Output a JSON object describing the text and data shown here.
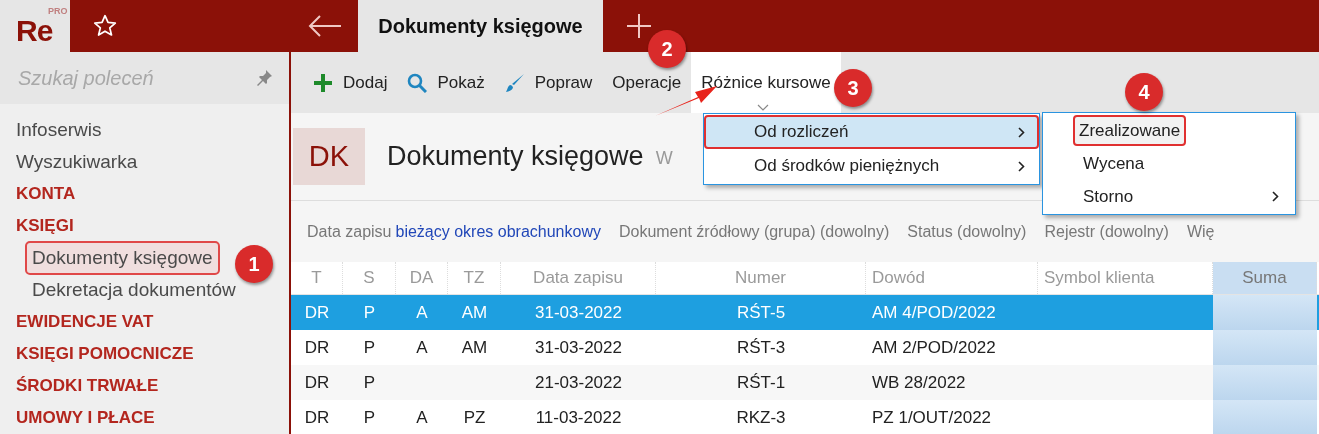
{
  "app": {
    "logo": "Re",
    "edition": "PRO"
  },
  "tabs": [
    {
      "label": "Dokumenty księgowe",
      "selected": true
    }
  ],
  "sidebar": {
    "search_placeholder": "Szukaj poleceń",
    "items": [
      {
        "label": "Infoserwis",
        "kind": "link",
        "selected": false
      },
      {
        "label": "Wyszukiwarka",
        "kind": "link",
        "selected": false
      },
      {
        "label": "KONTA",
        "kind": "section",
        "selected": false
      },
      {
        "label": "KSIĘGI",
        "kind": "section",
        "selected": false,
        "children": [
          {
            "label": "Dokumenty księgowe",
            "kind": "link",
            "selected": true
          },
          {
            "label": "Dekretacja dokumentów",
            "kind": "link",
            "selected": false
          }
        ]
      },
      {
        "label": "EWIDENCJE VAT",
        "kind": "section",
        "selected": false
      },
      {
        "label": "KSIĘGI POMOCNICZE",
        "kind": "section",
        "selected": false
      },
      {
        "label": "ŚRODKI TRWAŁE",
        "kind": "section",
        "selected": false
      },
      {
        "label": "UMOWY I PŁACE",
        "kind": "section",
        "selected": false
      }
    ]
  },
  "toolbar": [
    {
      "label": "Dodaj",
      "kind": "add",
      "open": false
    },
    {
      "label": "Pokaż",
      "kind": "show",
      "open": false
    },
    {
      "label": "Popraw",
      "kind": "edit",
      "open": false
    },
    {
      "label": "Operacje",
      "kind": "text",
      "open": false
    },
    {
      "label": "Różnice kursowe",
      "kind": "text",
      "open": true
    }
  ],
  "page_header": {
    "code": "DK",
    "title": "Dokumenty księgowe",
    "subtitle": "W"
  },
  "filters": [
    {
      "label": "Data zapisu",
      "value": "bieżący okres obrachunkowy"
    },
    {
      "label": "Dokument źródłowy (grupa) (dowolny)"
    },
    {
      "label": "Status (dowolny)"
    },
    {
      "label": "Rejestr (dowolny)"
    },
    {
      "label": "Wię"
    }
  ],
  "table": {
    "columns": [
      "T",
      "S",
      "DA",
      "TZ",
      "Data zapisu",
      "Numer",
      "Dowód",
      "Symbol klienta",
      "Suma"
    ],
    "rows": [
      {
        "selected": true,
        "cells": [
          "DR",
          "P",
          "A",
          "AM",
          "31-03-2022",
          "RŚT-5",
          "AM 4/POD/2022",
          "",
          ""
        ]
      },
      {
        "selected": false,
        "cells": [
          "DR",
          "P",
          "A",
          "AM",
          "31-03-2022",
          "RŚT-3",
          "AM 2/POD/2022",
          "",
          ""
        ]
      },
      {
        "selected": false,
        "cells": [
          "DR",
          "P",
          "",
          "",
          "21-03-2022",
          "RŚT-1",
          "WB 28/2022",
          "",
          ""
        ]
      },
      {
        "selected": false,
        "cells": [
          "DR",
          "P",
          "A",
          "PZ",
          "11-03-2022",
          "RKZ-3",
          "PZ 1/OUT/2022",
          "",
          ""
        ]
      }
    ]
  },
  "menu": [
    {
      "label": "Od rozliczeń",
      "selected": true,
      "outlined": true,
      "submenu": true
    },
    {
      "label": "Od środków pieniężnych",
      "selected": false,
      "outlined": false,
      "submenu": true
    }
  ],
  "submenu": [
    {
      "label": "Zrealizowane",
      "outlined": true,
      "submenu": false
    },
    {
      "label": "Wycena",
      "outlined": false,
      "submenu": false
    },
    {
      "label": "Storno",
      "outlined": false,
      "submenu": true
    }
  ],
  "callouts": [
    "1",
    "2",
    "3",
    "4"
  ]
}
